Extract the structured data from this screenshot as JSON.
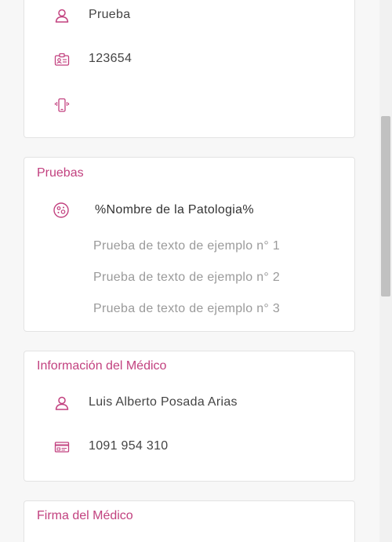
{
  "patient_card": {
    "name": "Prueba",
    "document": "123654",
    "phone": "",
    "icons": [
      "user-icon",
      "id-card-icon",
      "phone-icon"
    ]
  },
  "tests_card": {
    "title": "Pruebas",
    "pathology_name": "%Nombre de la Patologia%",
    "items": [
      "Prueba de texto de ejemplo n° 1",
      "Prueba de texto de ejemplo n° 2",
      "Prueba de texto de ejemplo n° 3"
    ],
    "icon": "virus-icon"
  },
  "doctor_card": {
    "title": "Información del Médico",
    "name": "Luis Alberto Posada Arias",
    "license": "1091 954 310",
    "icons": [
      "user-icon",
      "license-card-icon"
    ]
  },
  "signature_card": {
    "title": "Firma del Médico"
  },
  "colors": {
    "accent": "#c2417f",
    "muted_text": "#9a9a9a",
    "border": "#e3e3e3"
  }
}
